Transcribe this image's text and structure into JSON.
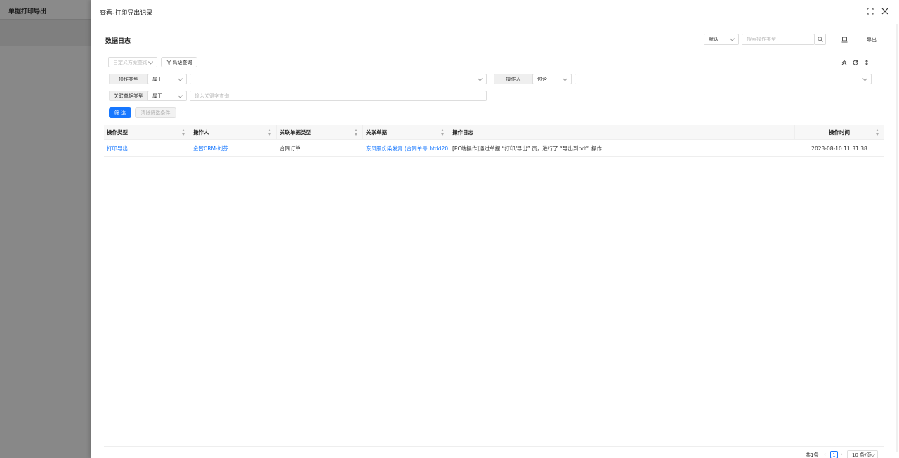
{
  "background": {
    "title": "单据打印导出"
  },
  "drawer": {
    "title": "查看-打印导出记录"
  },
  "panel": {
    "title": "数据日志",
    "view_select": "默认",
    "search_placeholder": "搜索操作类型",
    "export_label": "导出"
  },
  "filters": {
    "custom_scheme_placeholder": "自定义方案查询",
    "advanced_query_label": "高级查询",
    "row1": {
      "field1_label": "操作类型",
      "field1_op": "属于",
      "field2_label": "操作人",
      "field2_op": "包含"
    },
    "row2": {
      "field_label": "关联单据类型",
      "field_op": "属于",
      "keyword_placeholder": "输入关键字查询"
    },
    "filter_button": "筛 选",
    "clear_button": "清除筛选条件"
  },
  "table": {
    "columns": [
      "操作类型",
      "操作人",
      "关联单据类型",
      "关联单据",
      "操作日志",
      "操作时间"
    ],
    "rows": [
      {
        "type": "打印导出",
        "operator": "金智CRM-刘芬",
        "doc_type": "合同订单",
        "doc": "东风股份染发膏 (合同单号:htdd202...",
        "log": "[PC端操作]通过单据 “打印/导出” 页，进行了 “导出到pdf” 操作",
        "time": "2023-08-10 11:31:38"
      }
    ]
  },
  "pagination": {
    "total": "共1条",
    "current_page": "1",
    "page_size": "10 条/页"
  },
  "colors": {
    "primary": "#1677ff"
  }
}
